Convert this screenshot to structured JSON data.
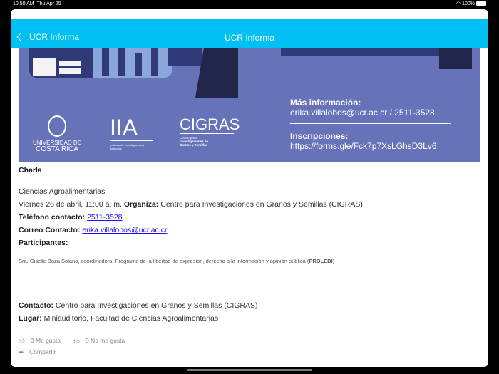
{
  "status_bar": {
    "time": "10:50 AM",
    "date": "Thu Apr 25",
    "battery": "100%"
  },
  "nav": {
    "back_label": "UCR Informa",
    "title": "UCR Informa"
  },
  "banner": {
    "logos": {
      "ucr_line1": "UNIVERSIDAD DE",
      "ucr_line2": "COSTA RICA",
      "iia": "IIA",
      "iia_sub": "Instituto de Investigaciones Agrícolas",
      "cigras": "CIGRAS",
      "cigras_sub1": "Centro para",
      "cigras_sub2": "Investigaciones en Granos y Semillas"
    },
    "more_info_label": "Más información:",
    "more_info_value": "erika.villalobos@ucr.ac.cr / 2511-3528",
    "registration_label": "Inscripciones:",
    "registration_value": "https://forms.gle/Fck7p7XsLGhsD3Lv6"
  },
  "article": {
    "type": "Charla",
    "category": "Ciencias Agroalimentarias",
    "date": "Viernes 26 de abril, 11:00 a. m.",
    "organiza_label": "Organiza:",
    "organiza_value": "Centro para Investigaciones en Granos y Semillas (CIGRAS)",
    "phone_label": "Teléfono contacto:",
    "phone_value": "2511-3528",
    "email_label": "Correo Contacto:",
    "email_value": "erika.villalobos@ucr.ac.cr",
    "participants_label": "Participantes:",
    "participants_text": "Sra. Giselle Boza Solano, coordinadora, Programa de la libertad de expresión, derecho a la información y opinión pública (",
    "participants_bold": "PROLEDI",
    "participants_end": ")",
    "contact_label": "Contacto:",
    "contact_value": "Centro para Investigaciones en Granos y Semillas (CIGRAS)",
    "place_label": "Lugar:",
    "place_value": "Miniauditorio, Facultad de Ciencias Agroalimentarias"
  },
  "actions": {
    "like": "0 Me gusta",
    "dislike": "0 No me gusta",
    "share": "Compartir"
  },
  "colors": {
    "nav": "#00c0f3",
    "banner": "#6673b8",
    "link": "#1a0dff"
  }
}
